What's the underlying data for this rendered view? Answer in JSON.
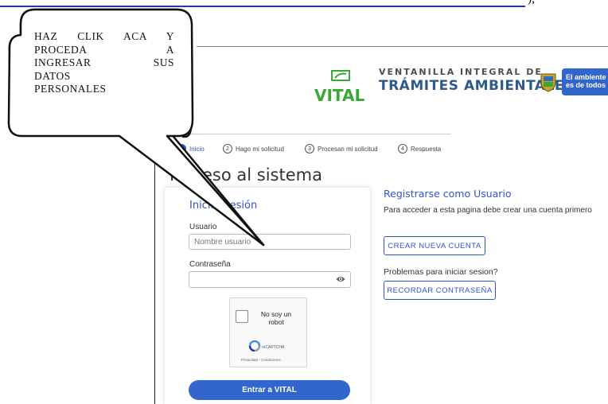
{
  "header": {
    "brand_short": "VITAL",
    "brand_line1": "VENTANILLA INTEGRAL DE",
    "brand_line2": "TRÁMITES AMBIENTALES",
    "ambiente_line1": "El ambiente",
    "ambiente_line2": "es de todos"
  },
  "top_fragment": {
    "trailing": ");"
  },
  "steps": [
    {
      "number": "1",
      "label": "Inicio",
      "active": true
    },
    {
      "number": "2",
      "label": "Hago mi solicitud",
      "active": false
    },
    {
      "number": "3",
      "label": "Procesan mi solicitud",
      "active": false
    },
    {
      "number": "4",
      "label": "Respuesta",
      "active": false
    }
  ],
  "page_title": "Ingreso al sistema",
  "login": {
    "title": "Iniciar sesión",
    "user_label": "Usuario",
    "user_placeholder": "Nombre usuario",
    "password_label": "Contraseña",
    "password_value": "",
    "submit_label": "Entrar a VITAL"
  },
  "captcha": {
    "checkbox_label": "No soy un robot",
    "brand": "reCAPTCHA",
    "footer": "Privacidad - Condiciones"
  },
  "register": {
    "title": "Registrarse como Usuario",
    "description": "Para acceder a esta pagina debe crear una cuenta primero",
    "create_button": "CREAR NUEVA CUENTA",
    "problems_title": "Problemas para iniciar sesion?",
    "remember_button": "RECORDAR CONTRASEÑA"
  },
  "callout": {
    "lines": [
      "HAZ CLIK ACA Y",
      "PROCEDA A",
      "INGRESAR SUS",
      "DATOS",
      "PERSONALES"
    ]
  },
  "colors": {
    "primary_blue": "#3366cc",
    "brand_green": "#3aa835",
    "brand_navy": "#2f5a8a"
  }
}
